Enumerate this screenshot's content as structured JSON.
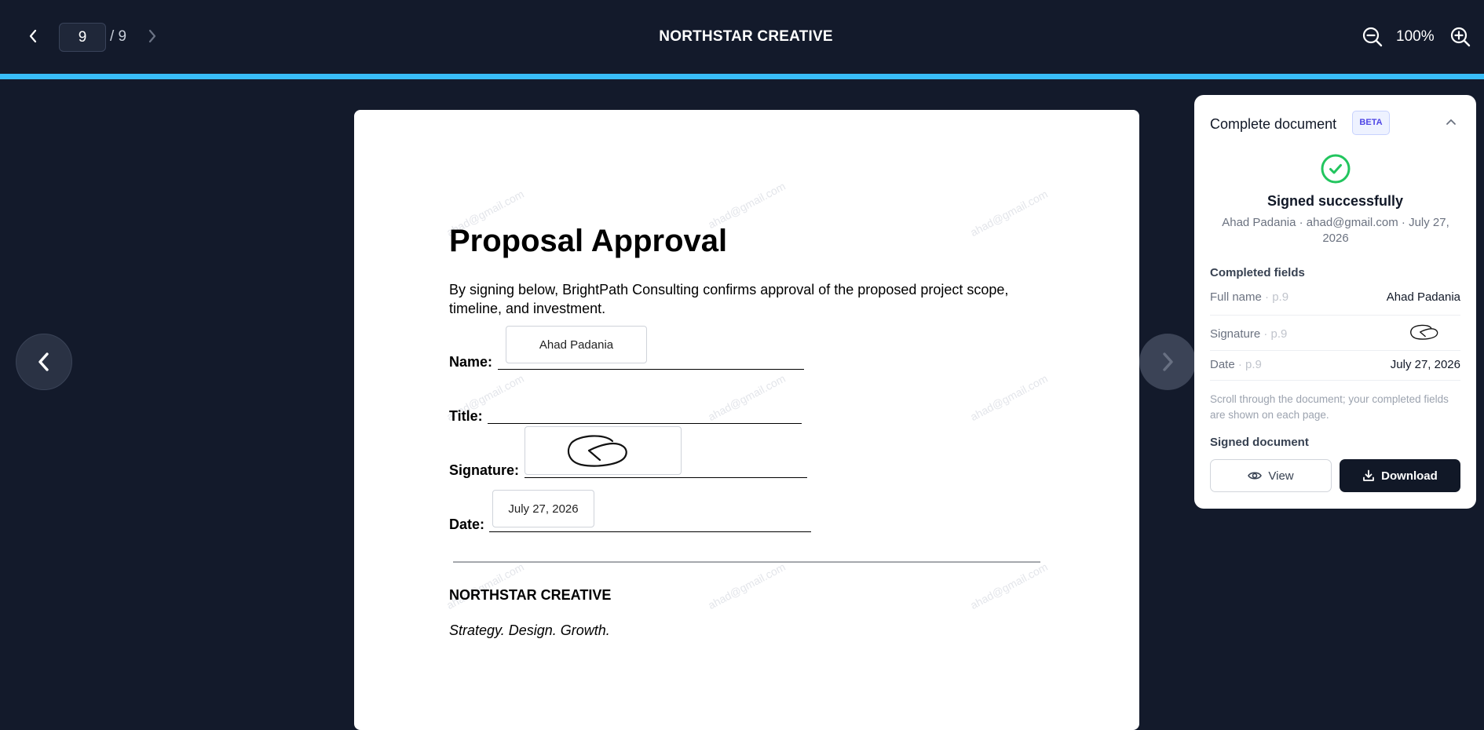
{
  "toolbar": {
    "page_current": "9",
    "page_total": "/ 9",
    "title": "NORTHSTAR CREATIVE",
    "zoom": "100%"
  },
  "document": {
    "watermark": "ahad@gmail.com",
    "heading": "Proposal Approval",
    "intro": "By signing below, BrightPath Consulting confirms approval of the proposed project scope, timeline, and investment.",
    "name_label": "Name:",
    "name_value": "Ahad Padania",
    "title_label": "Title:",
    "signature_label": "Signature:",
    "date_label": "Date:",
    "date_value": "July 27, 2026",
    "company": "NORTHSTAR CREATIVE",
    "tagline": "Strategy. Design. Growth."
  },
  "panel": {
    "title": "Complete document",
    "badge": "BETA",
    "status_title": "Signed successfully",
    "status_meta": "Ahad Padania · ahad@gmail.com · July 27, 2026",
    "completed_label": "Completed fields",
    "fields": [
      {
        "name": "Full name",
        "page": " · p.9",
        "value": "Ahad Padania"
      },
      {
        "name": "Signature",
        "page": " · p.9",
        "value": ""
      },
      {
        "name": "Date",
        "page": " · p.9",
        "value": "July 27, 2026"
      }
    ],
    "hint": "Scroll through the document; your completed fields are shown on each page.",
    "signed_doc_label": "Signed document",
    "view_label": "View",
    "download_label": "Download"
  },
  "colors": {
    "background": "#131a2b",
    "progress": "#38bdf8",
    "success": "#22c55e",
    "primary_button": "#111827"
  }
}
